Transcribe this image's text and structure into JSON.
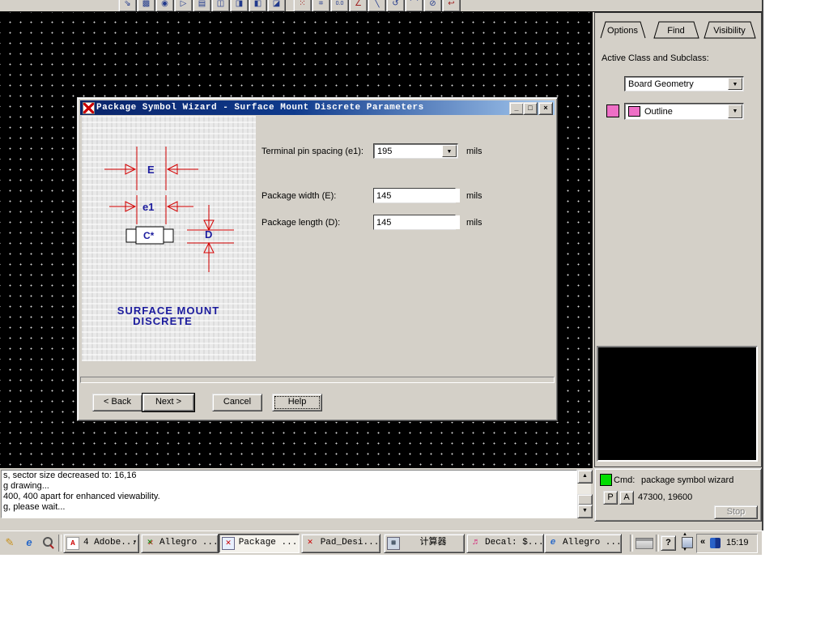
{
  "colors": {
    "titlebar_start": "#0a246a",
    "titlebar_end": "#a6caf0",
    "status_green": "#00dd00",
    "swatch_pink": "#ee6fc6",
    "diagram_red": "#d40000",
    "diagram_blue": "#1c1c9e"
  },
  "toolbar": {
    "group1": [
      "⇘",
      "▩",
      "◉",
      "▷",
      "▤",
      "◫",
      "◨",
      "◧",
      "◪"
    ],
    "group2": [
      "⁙",
      "⌗",
      "0.0",
      "∠",
      "╲",
      "↺",
      "⌒",
      "⊘",
      "↩",
      "✎"
    ]
  },
  "wizard_dialog": {
    "title": "Package Symbol Wizard - Surface Mount Discrete Parameters",
    "window_buttons": {
      "minimize": "_",
      "maximize": "□",
      "close": "×"
    },
    "diagram": {
      "label_e": "E",
      "label_e1": "e1",
      "label_c": "C*",
      "label_d": "D",
      "caption_line1": "SURFACE MOUNT",
      "caption_line2": "DISCRETE"
    },
    "fields": [
      {
        "label": "Terminal pin spacing (e1):",
        "value": "195",
        "unit": "mils"
      },
      {
        "label": "Package width (E):",
        "value": "145",
        "unit": "mils"
      },
      {
        "label": "Package length (D):",
        "value": "145",
        "unit": "mils"
      }
    ],
    "buttons": {
      "back": "< Back",
      "next": "Next >",
      "cancel": "Cancel",
      "help": "Help"
    }
  },
  "side_panel": {
    "tabs": [
      {
        "label": "Options"
      },
      {
        "label": "Find"
      },
      {
        "label": "Visibility"
      }
    ],
    "active_class_label": "Active Class and Subclass:",
    "class_dropdown_value": "Board Geometry",
    "subclass_dropdown_value": "Outline"
  },
  "console": {
    "lines": [
      "s, sector size decreased to: 16,16",
      "g drawing...",
      "400, 400 apart for enhanced viewability.",
      "g, please wait..."
    ]
  },
  "command_panel": {
    "cmd_label": "Cmd:",
    "cmd_value": "package symbol wizard",
    "p_button": "P",
    "a_button": "A",
    "coordinates": "47300, 19600",
    "stop_button": "Stop"
  },
  "taskbar": {
    "buttons": [
      {
        "label": "4 Adobe...",
        "dropdown": "▾"
      },
      {
        "label": "Allegro ..."
      },
      {
        "label": "Package ..."
      },
      {
        "label": "Pad_Desi..."
      },
      {
        "label": "计算器"
      },
      {
        "label": "Decal: $..."
      },
      {
        "label": "Allegro ..."
      }
    ],
    "tray": {
      "help_button": "?",
      "chevron": "«",
      "time": "15:19"
    }
  }
}
